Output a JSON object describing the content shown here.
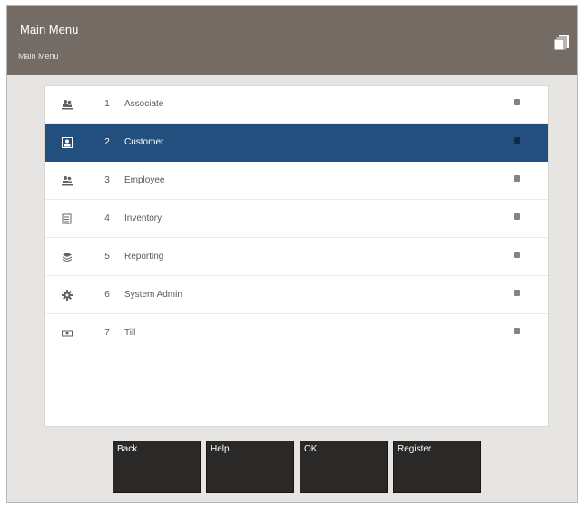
{
  "header": {
    "title": "Main Menu",
    "crumb": "Main Menu",
    "icon": "stacked-windows-icon"
  },
  "menu_items": [
    {
      "num": "1",
      "label": "Associate",
      "icon": "people-icon",
      "selected": false
    },
    {
      "num": "2",
      "label": "Customer",
      "icon": "customer-card-icon",
      "selected": true
    },
    {
      "num": "3",
      "label": "Employee",
      "icon": "people-icon",
      "selected": false
    },
    {
      "num": "4",
      "label": "Inventory",
      "icon": "inventory-icon",
      "selected": false
    },
    {
      "num": "5",
      "label": "Reporting",
      "icon": "stack-layers-icon",
      "selected": false
    },
    {
      "num": "6",
      "label": "System Admin",
      "icon": "gear-icon",
      "selected": false
    },
    {
      "num": "7",
      "label": "Till",
      "icon": "cash-drawer-icon",
      "selected": false
    }
  ],
  "actions": [
    "Back",
    "Help",
    "OK",
    "Register"
  ],
  "colors": {
    "header_bg": "#756b65",
    "selected_row": "#234f7f",
    "button_bg": "#2b2927",
    "frame_bg": "#e6e5e3"
  }
}
